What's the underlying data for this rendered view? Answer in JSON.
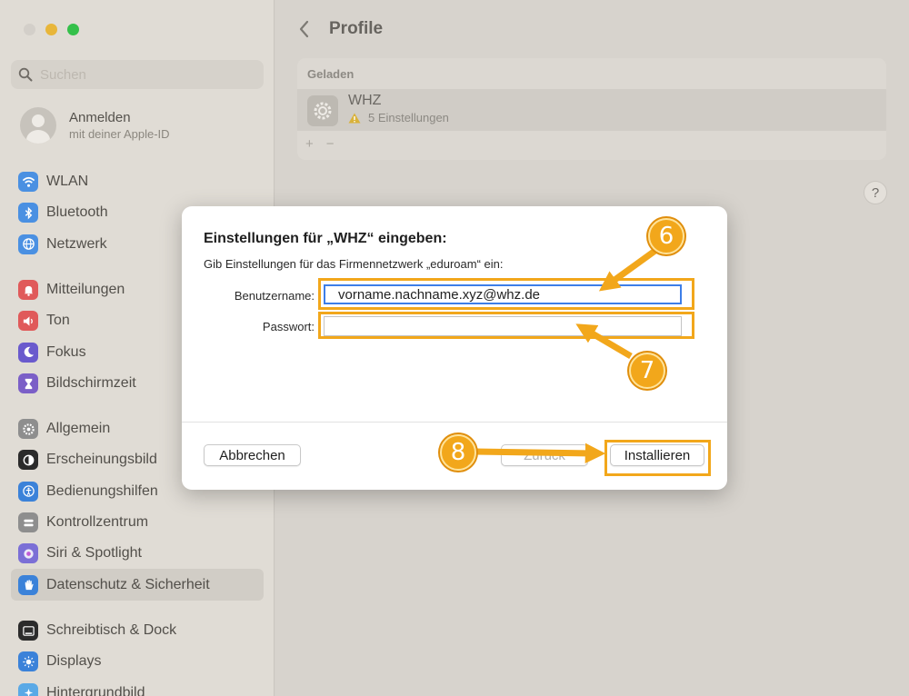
{
  "search": {
    "placeholder": "Suchen"
  },
  "account": {
    "title": "Anmelden",
    "subtitle": "mit deiner Apple-ID"
  },
  "sidebar": {
    "group1": [
      {
        "label": "WLAN",
        "icon": "wifi-icon",
        "color": "#4a90e2"
      },
      {
        "label": "Bluetooth",
        "icon": "bluetooth-icon",
        "color": "#4a90e2"
      },
      {
        "label": "Netzwerk",
        "icon": "globe-icon",
        "color": "#4a90e2"
      }
    ],
    "group2": [
      {
        "label": "Mitteilungen",
        "icon": "bell-icon",
        "color": "#e05a5a"
      },
      {
        "label": "Ton",
        "icon": "speaker-icon",
        "color": "#e05a5a"
      },
      {
        "label": "Fokus",
        "icon": "moon-icon",
        "color": "#6a5acd"
      },
      {
        "label": "Bildschirmzeit",
        "icon": "hourglass-icon",
        "color": "#7b5fc7"
      }
    ],
    "group3": [
      {
        "label": "Allgemein",
        "icon": "gear-icon",
        "color": "#8e8e8e"
      },
      {
        "label": "Erscheinungsbild",
        "icon": "appearance-icon",
        "color": "#2b2b2b"
      },
      {
        "label": "Bedienungshilfen",
        "icon": "accessibility-icon",
        "color": "#3b82d9"
      },
      {
        "label": "Kontrollzentrum",
        "icon": "control-center-icon",
        "color": "#8e8e8e"
      },
      {
        "label": "Siri & Spotlight",
        "icon": "siri-icon",
        "color": "#7b6fd6"
      },
      {
        "label": "Datenschutz & Sicherheit",
        "icon": "hand-icon",
        "color": "#3b82d9"
      }
    ],
    "group4": [
      {
        "label": "Schreibtisch & Dock",
        "icon": "dock-icon",
        "color": "#2b2b2b"
      },
      {
        "label": "Displays",
        "icon": "sun-icon",
        "color": "#3b82d9"
      },
      {
        "label": "Hintergrundbild",
        "icon": "wallpaper-icon",
        "color": "#5aa9e6"
      }
    ]
  },
  "main": {
    "title": "Profile",
    "section": "Geladen",
    "profile": {
      "name": "WHZ",
      "settings": "5 Einstellungen"
    },
    "add": "+",
    "remove": "−",
    "help": "?"
  },
  "dialog": {
    "title": "Einstellungen für „WHZ“ eingeben:",
    "subtitle": "Gib Einstellungen für das Firmennetzwerk „eduroam“ ein:",
    "username_label": "Benutzername:",
    "username_value": "vorname.nachname.xyz@whz.de",
    "password_label": "Passwort:",
    "password_value": "",
    "cancel": "Abbrechen",
    "back": "Zurück",
    "install": "Installieren"
  },
  "annotations": {
    "step6": "6",
    "step7": "7",
    "step8": "8",
    "color": "#f2a71b"
  }
}
